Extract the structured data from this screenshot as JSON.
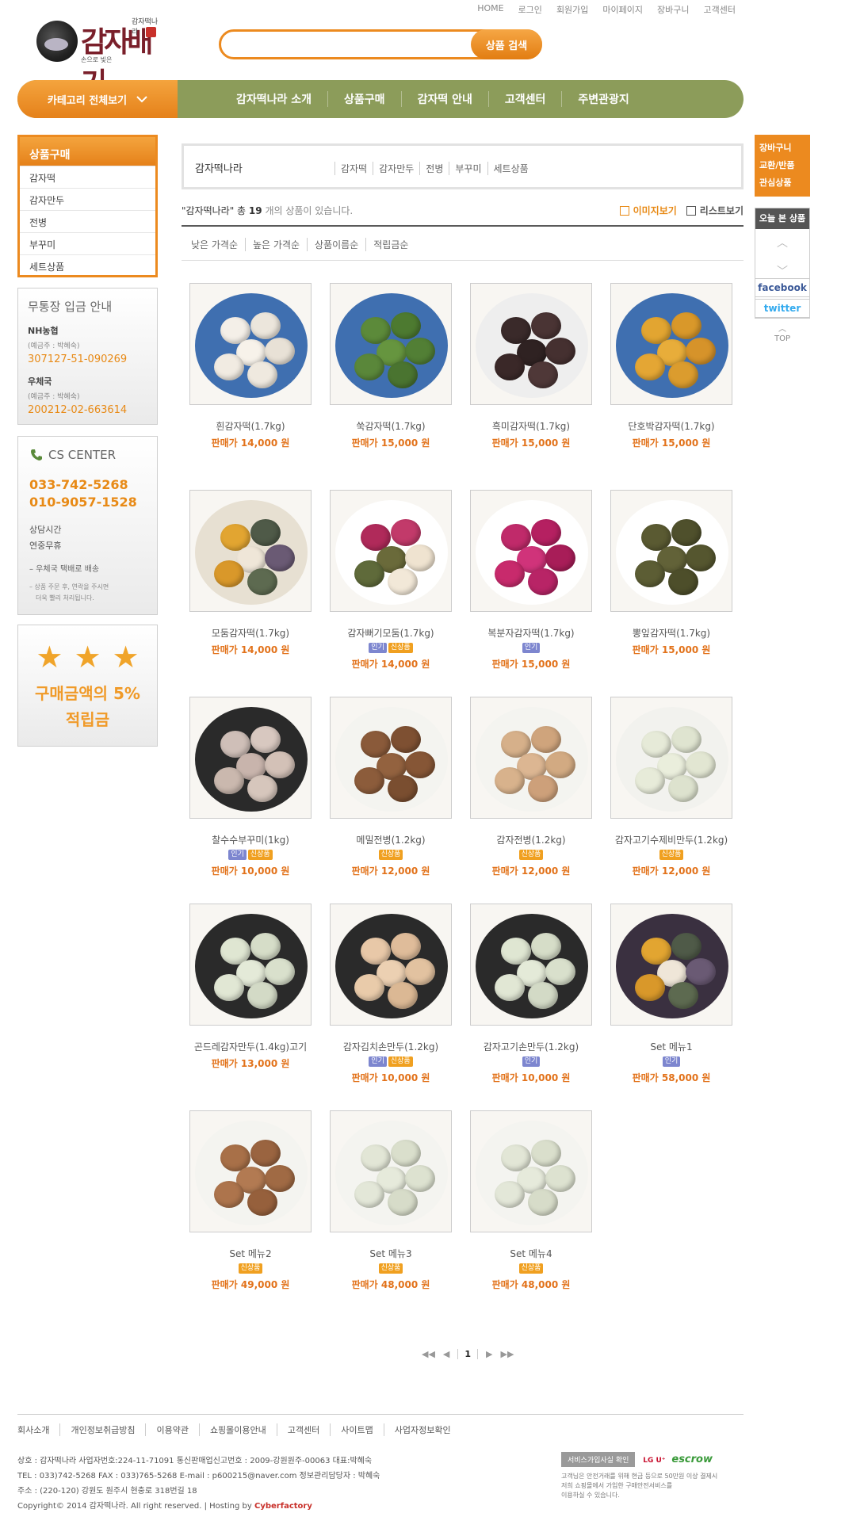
{
  "top_links": [
    "HOME",
    "로그인",
    "회원가입",
    "마이페이지",
    "장바구니",
    "고객센터"
  ],
  "logo": {
    "big_text": "감자배기",
    "small_top": "감자떡나라",
    "small_bottom": "손으로 빚은"
  },
  "search": {
    "placeholder": "",
    "button": "상품 검색"
  },
  "nav": {
    "category_button": "카테고리 전체보기",
    "items": [
      "감자떡나라 소개",
      "상품구매",
      "감자떡 안내",
      "고객센터",
      "주변관광지"
    ]
  },
  "sidebar": {
    "title": "상품구매",
    "items": [
      "감자떡",
      "감자만두",
      "전병",
      "부꾸미",
      "세트상품"
    ]
  },
  "bank": {
    "title": "무통장 입금 안내",
    "accounts": [
      {
        "bank": "NH농협",
        "holder": "(예금주 : 박혜숙)",
        "number": "307127-51-090269"
      },
      {
        "bank": "우체국",
        "holder": "(예금주 : 박혜숙)",
        "number": "200212-02-663614"
      }
    ]
  },
  "cs": {
    "title": "CS CENTER",
    "phones": [
      "033-742-5268",
      "010-9057-1528"
    ],
    "hours_label": "상담시간",
    "hours_value": "연중무휴",
    "note": "– 우체국 택배로 배송",
    "note2_line1": "– 상품 주문 후, 연락을 주시면",
    "note2_line2": "더욱 빨리 처리됩니다."
  },
  "points": {
    "line1": "구매금액의 5%",
    "line2": "적립금"
  },
  "quick": {
    "items": [
      "장바구니",
      "교환/반품",
      "관심상품"
    ],
    "recent_title": "오늘 본 상품",
    "facebook": "facebook",
    "twitter": "twitter",
    "top": "TOP"
  },
  "category_box": {
    "name": "감자떡나라",
    "subs": [
      "감자떡",
      "감자만두",
      "전병",
      "부꾸미",
      "세트상품"
    ]
  },
  "count": {
    "prefix": "\"감자떡나라\" 총 ",
    "number": "19",
    "suffix": " 개의 상품이 있습니다."
  },
  "views": {
    "image": "이미지보기",
    "list": "리스트보기"
  },
  "sort": [
    "낮은 가격순",
    "높은 가격순",
    "상품이름순",
    "적립금순"
  ],
  "products": [
    {
      "name": "흰감자떡(1.7kg)",
      "price": "판매가 14,000 원",
      "badges": []
    },
    {
      "name": "쑥감자떡(1.7kg)",
      "price": "판매가 15,000 원",
      "badges": []
    },
    {
      "name": "흑미감자떡(1.7kg)",
      "price": "판매가 15,000 원",
      "badges": []
    },
    {
      "name": "단호박감자떡(1.7kg)",
      "price": "판매가 15,000 원",
      "badges": []
    },
    {
      "name": "모둠감자떡(1.7kg)",
      "price": "판매가 14,000 원",
      "badges": []
    },
    {
      "name": "감자뻐기모둠(1.7kg)",
      "price": "판매가 14,000 원",
      "badges": [
        "인기",
        "신상품"
      ]
    },
    {
      "name": "복분자감자떡(1.7kg)",
      "price": "판매가 15,000 원",
      "badges": [
        "인기"
      ]
    },
    {
      "name": "뽕잎감자떡(1.7kg)",
      "price": "판매가 15,000 원",
      "badges": []
    },
    {
      "name": "찰수수부꾸미(1kg)",
      "price": "판매가 10,000 원",
      "badges": [
        "인기",
        "신상품"
      ]
    },
    {
      "name": "메밀전병(1.2kg)",
      "price": "판매가 12,000 원",
      "badges": [
        "신상품"
      ]
    },
    {
      "name": "감자전병(1.2kg)",
      "price": "판매가 12,000 원",
      "badges": [
        "신상품"
      ]
    },
    {
      "name": "감자고기수제비만두(1.2kg)",
      "price": "판매가 12,000 원",
      "badges": [
        "신상품"
      ]
    },
    {
      "name": "곤드레감자만두(1.4kg)고기",
      "price": "판매가 13,000 원",
      "badges": []
    },
    {
      "name": "감자김치손만두(1.2kg)",
      "price": "판매가 10,000 원",
      "badges": [
        "인기",
        "신상품"
      ]
    },
    {
      "name": "감자고기손만두(1.2kg)",
      "price": "판매가 10,000 원",
      "badges": [
        "인기"
      ]
    },
    {
      "name": "Set 메뉴1",
      "price": "판매가 58,000 원",
      "badges": [
        "인기"
      ]
    },
    {
      "name": "Set 메뉴2",
      "price": "판매가 49,000 원",
      "badges": [
        "신상품"
      ]
    },
    {
      "name": "Set 메뉴3",
      "price": "판매가 48,000 원",
      "badges": [
        "신상품"
      ]
    },
    {
      "name": "Set 메뉴4",
      "price": "판매가 48,000 원",
      "badges": [
        "신상품"
      ]
    }
  ],
  "pager": {
    "current": "1"
  },
  "footer": {
    "menu": [
      "회사소개",
      "개인정보취급방침",
      "이용약관",
      "쇼핑몰이용안내",
      "고객센터",
      "사이트맵",
      "사업자정보확인"
    ],
    "line1": "상호 : 감자떡나라 사업자번호:224-11-71091 통신판매업신고번호 : 2009-강원원주-00063 대표:박혜숙",
    "line2": "TEL : 033)742-5268 FAX : 033)765-5268 E-mail : p600215@naver.com 정보관리담당자 : 박혜숙",
    "line3": "주소 : (220-120) 강원도 원주시 현충로 318번길 18",
    "copyright": "Copyright© 2014 감자떡나라. All right reserved.   |   Hosting by ",
    "hosting": "Cyberfactory",
    "escrow_button": "서비스가입사실 확인",
    "lg": "LG U⁺",
    "escrow": "escrow",
    "escrow_text1": "고객님은 안전거래를 위해 현금 등으로 50만원 이상 결제시",
    "escrow_text2": "저희 쇼핑몰에서 가입한 구매안전서비스를",
    "escrow_text3": "이용하실 수 있습니다."
  },
  "colors": {
    "accent": "#ec8a1f",
    "nav_green": "#8c9c5a",
    "price": "#e2721a"
  }
}
